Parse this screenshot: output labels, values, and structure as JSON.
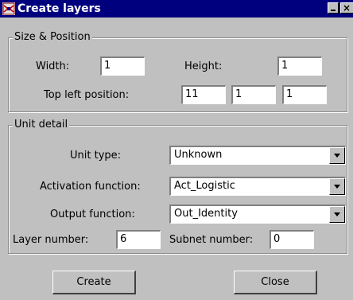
{
  "window": {
    "title": "Create layers"
  },
  "size_position": {
    "legend": "Size & Position",
    "width_label": "Width:",
    "width_value": "1",
    "height_label": "Height:",
    "height_value": "1",
    "top_left_label": "Top left position:",
    "pos_x": "11",
    "pos_y": "1",
    "pos_z": "1"
  },
  "unit_detail": {
    "legend": "Unit detail",
    "unit_type_label": "Unit type:",
    "unit_type_value": "Unknown",
    "activation_label": "Activation function:",
    "activation_value": "Act_Logistic",
    "output_label": "Output function:",
    "output_value": "Out_Identity",
    "layer_number_label": "Layer number:",
    "layer_number_value": "6",
    "subnet_number_label": "Subnet number:",
    "subnet_number_value": "0"
  },
  "buttons": {
    "create": "Create",
    "close": "Close"
  },
  "icons": {
    "app": "app-icon",
    "minimize": "minimize-icon",
    "close": "close-icon",
    "dropdown": "chevron-down-icon"
  }
}
